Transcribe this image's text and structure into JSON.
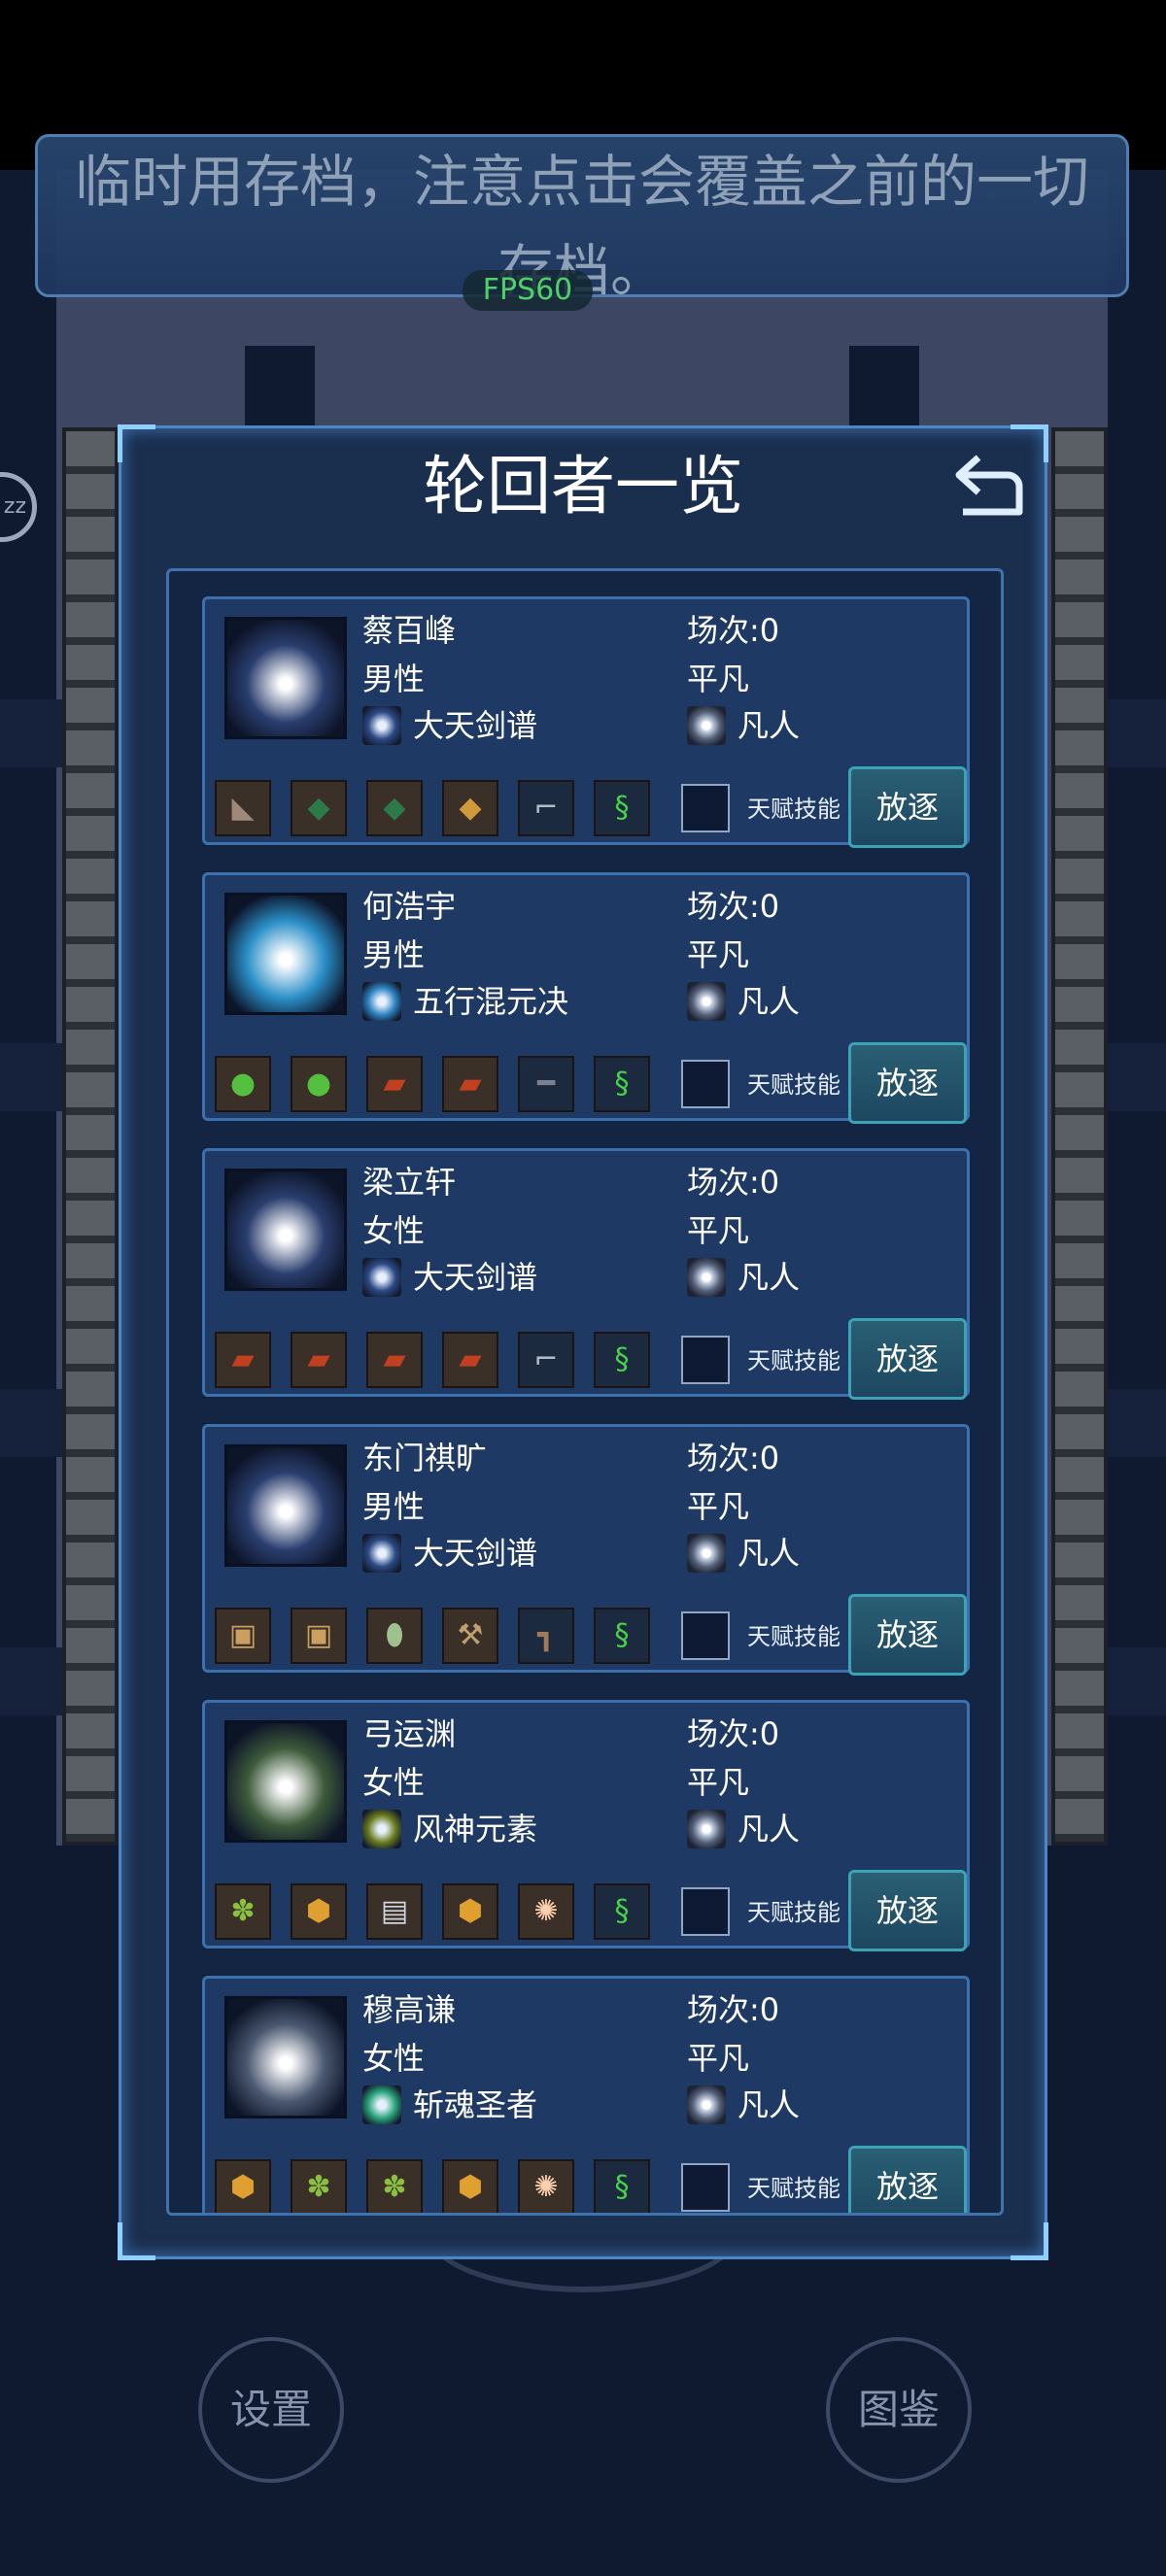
{
  "banner": {
    "text": "临时用存档，注意点击会覆盖之前的一切存档。"
  },
  "fps": {
    "label": "FPS60"
  },
  "side_button": {
    "label": "zz"
  },
  "dialog": {
    "title": "轮回者一览",
    "back_icon": "return-arrow-icon"
  },
  "talent_label": "天赋技能",
  "exile_label": "放逐",
  "characters": [
    {
      "name": "蔡百峰",
      "gender": "男性",
      "count": "场次:0",
      "grade": "平凡",
      "skill": "大天剑谱",
      "title": "凡人",
      "portrait_color": "#2a3e6e",
      "skill_color": "#2c4a86",
      "items": [
        "horn",
        "crystal-green",
        "crystal-green",
        "crystal-gold",
        "rifle",
        "dna"
      ]
    },
    {
      "name": "何浩宇",
      "gender": "男性",
      "count": "场次:0",
      "grade": "平凡",
      "skill": "五行混元决",
      "title": "凡人",
      "portrait_color": "#2b8fc8",
      "skill_color": "#2e83c2",
      "items": [
        "gem-green",
        "gem-green",
        "helmet-red",
        "helmet-red",
        "shotgun",
        "dna"
      ]
    },
    {
      "name": "梁立轩",
      "gender": "女性",
      "count": "场次:0",
      "grade": "平凡",
      "skill": "大天剑谱",
      "title": "凡人",
      "portrait_color": "#2a3e6e",
      "skill_color": "#2c4a86",
      "items": [
        "helmet-red",
        "helmet-red",
        "helmet-red",
        "helmet-red",
        "rifle",
        "dna"
      ]
    },
    {
      "name": "东门祺旷",
      "gender": "男性",
      "count": "场次:0",
      "grade": "平凡",
      "skill": "大天剑谱",
      "title": "凡人",
      "portrait_color": "#2a3e6e",
      "skill_color": "#2c4a86",
      "items": [
        "chest",
        "chest",
        "leaf",
        "pickaxe",
        "pistol",
        "dna"
      ]
    },
    {
      "name": "弓运渊",
      "gender": "女性",
      "count": "场次:0",
      "grade": "平凡",
      "skill": "风神元素",
      "title": "凡人",
      "portrait_color": "#3d5a3a",
      "skill_color": "#6a7d1e",
      "items": [
        "herb",
        "amber",
        "book",
        "amber",
        "orb",
        "dna"
      ]
    },
    {
      "name": "穆高谦",
      "gender": "女性",
      "count": "场次:0",
      "grade": "平凡",
      "skill": "斩魂圣者",
      "title": "凡人",
      "portrait_color": "#4a5870",
      "skill_color": "#2aa37a",
      "items": [
        "amber",
        "herb",
        "herb",
        "amber",
        "orb",
        "dna"
      ]
    }
  ],
  "bottom": {
    "settings": "设置",
    "gallery": "图鉴"
  }
}
